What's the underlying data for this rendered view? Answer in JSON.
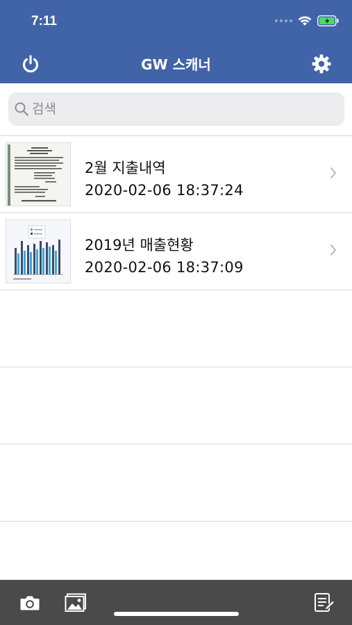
{
  "status_bar": {
    "time": "7:11"
  },
  "header": {
    "title": "GW 스캐너"
  },
  "search": {
    "placeholder": "검색"
  },
  "documents": [
    {
      "title": "2월 지출내역",
      "date": "2020-02-06 18:37:24",
      "thumbnail": "receipt"
    },
    {
      "title": "2019년 매출현황",
      "date": "2020-02-06 18:37:09",
      "thumbnail": "bar-chart"
    }
  ],
  "colors": {
    "header": "#4163a8",
    "toolbar": "#4a4a4a",
    "battery": "#4cd964"
  },
  "icons": [
    "power-icon",
    "gear-icon",
    "search-icon",
    "chevron-right-icon",
    "camera-icon",
    "gallery-icon",
    "edit-list-icon",
    "wifi-icon",
    "battery-icon"
  ]
}
